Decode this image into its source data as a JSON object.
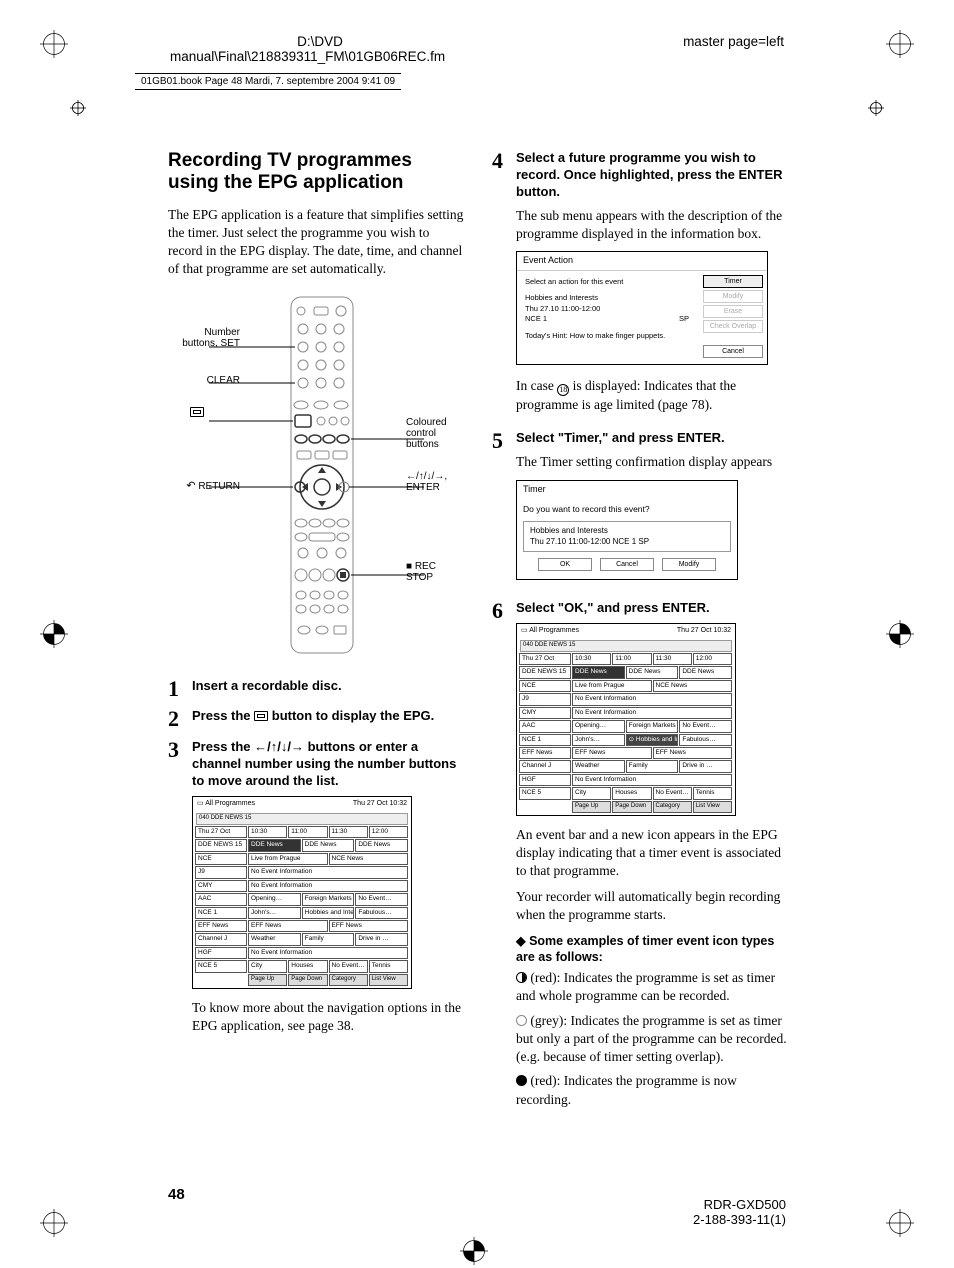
{
  "header": {
    "path_top": "D:\\DVD",
    "path_mid": "manual\\Final\\218839311_FM\\01GB06REC.fm",
    "master": "master page=left",
    "book_info": "01GB01.book  Page 48  Mardi, 7. septembre 2004  9:41 09"
  },
  "page_number": "48",
  "model": {
    "name": "RDR-GXD500",
    "code": "2-188-393-11(1)"
  },
  "section": {
    "title": "Recording TV programmes using the EPG application",
    "intro": "The EPG application is a feature that simplifies setting the timer. Just select the programme you wish to record in the EPG display. The date, time, and channel of that programme are set automatically."
  },
  "remote_labels": {
    "number_set": "Number buttons, SET",
    "clear": "CLEAR",
    "coloured": "Coloured control buttons",
    "return": "RETURN",
    "enter": "←/↑/↓/→, ENTER",
    "rec_stop": "■ REC STOP"
  },
  "steps": {
    "s1": {
      "num": "1",
      "heading": "Insert a recordable disc."
    },
    "s2": {
      "num": "2",
      "heading_a": "Press the ",
      "heading_b": " button to display the EPG."
    },
    "s3": {
      "num": "3",
      "heading": "Press the ←/↑/↓/→ buttons or enter a channel number using the number buttons to move around the list.",
      "after": "To know more about the navigation options in the EPG application, see page 38."
    },
    "s4": {
      "num": "4",
      "heading": "Select a future programme you wish to record. Once highlighted, press the ENTER button.",
      "text": "The sub menu appears with the description of the programme displayed in the information box.",
      "after_a": "In case ",
      "after_b": " is displayed: Indicates that the programme is age limited (page 78)."
    },
    "s5": {
      "num": "5",
      "heading": "Select \"Timer,\" and press ENTER.",
      "text": "The Timer setting confirmation display appears"
    },
    "s6": {
      "num": "6",
      "heading": "Select \"OK,\" and press ENTER.",
      "after1": "An event bar and a new icon appears in the EPG display indicating that a timer event is associated to that programme.",
      "after2": "Your recorder will automatically begin recording when the programme starts."
    }
  },
  "epg": {
    "title": "All Programmes",
    "datetime": "Thu 27 Oct  10:32",
    "numrow": "040    DDE NEWS 15",
    "date_cell": "Thu 27 Oct",
    "times": [
      "10:30",
      "11:00",
      "11:30",
      "12:00"
    ],
    "rows": [
      {
        "ch": "DDE NEWS 15",
        "cells": [
          "DDE News",
          "DDE News",
          "DDE News"
        ],
        "sel": 0
      },
      {
        "ch": "NCE",
        "cells": [
          "Live from Prague",
          "NCE News"
        ]
      },
      {
        "ch": "J9",
        "cells": [
          "No Event Information"
        ]
      },
      {
        "ch": "CMY",
        "cells": [
          "No Event Information"
        ]
      },
      {
        "ch": "AAC",
        "cells": [
          "Opening…",
          "Foreign Markets - Mor…",
          "No Event…"
        ]
      },
      {
        "ch": "NCE 1",
        "cells": [
          "John's…",
          "Hobbies and Interests",
          "Fabulous…"
        ]
      },
      {
        "ch": "EFF News",
        "cells": [
          "EFF News",
          "EFF News"
        ]
      },
      {
        "ch": "Channel J",
        "cells": [
          "Weather",
          "Family",
          "Drive in …"
        ]
      },
      {
        "ch": "HGF",
        "cells": [
          "No Event Information"
        ]
      },
      {
        "ch": "NCE 5",
        "cells": [
          "City",
          "Houses",
          "No Event…",
          "Tennis"
        ]
      }
    ],
    "footer": [
      "Page Up",
      "Page Down",
      "Category",
      "List View"
    ]
  },
  "epg2": {
    "rows": [
      {
        "ch": "DDE NEWS 15",
        "cells": [
          "DDE News",
          "DDE News",
          "DDE News"
        ],
        "sel": 0
      },
      {
        "ch": "NCE",
        "cells": [
          "Live from Prague",
          "NCE News"
        ]
      },
      {
        "ch": "J9",
        "cells": [
          "No Event Information"
        ]
      },
      {
        "ch": "CMY",
        "cells": [
          "No Event Information"
        ]
      },
      {
        "ch": "AAC",
        "cells": [
          "Opening…",
          "Foreign Markets - Mor…",
          "No Event…"
        ]
      },
      {
        "ch": "NCE 1",
        "cells": [
          "John's…",
          "⊙ Hobbies and Interests",
          "Fabulous…"
        ],
        "hl": 1
      },
      {
        "ch": "EFF News",
        "cells": [
          "EFF News",
          "EFF News"
        ]
      },
      {
        "ch": "Channel J",
        "cells": [
          "Weather",
          "Family",
          "Drive in …"
        ]
      },
      {
        "ch": "HGF",
        "cells": [
          "No Event Information"
        ]
      },
      {
        "ch": "NCE 5",
        "cells": [
          "City",
          "Houses",
          "No Event…",
          "Tennis"
        ]
      }
    ]
  },
  "event_dialog": {
    "title": "Event Action",
    "subtitle": "Select an action for this event",
    "prog_name": "Hobbies and Interests",
    "prog_time": "Thu 27.10   11:00-12:00",
    "prog_ch": "NCE 1",
    "prog_quality": "SP",
    "hint": "Today's Hint: How to make finger puppets.",
    "buttons": {
      "timer": "Timer",
      "modify": "Modify",
      "erase": "Erase",
      "check": "Check Overlap",
      "cancel": "Cancel"
    }
  },
  "timer_dialog": {
    "title": "Timer",
    "question": "Do you want to record this event?",
    "prog_name": "Hobbies and Interests",
    "prog_line": "Thu 27.10  11:00-12:00  NCE 1   SP",
    "ok": "OK",
    "cancel": "Cancel",
    "modify": "Modify"
  },
  "icon_examples": {
    "heading": "◆ Some examples of timer event icon types are as follows:",
    "red": " (red): Indicates the programme is set as timer and whole programme can be recorded.",
    "grey": " (grey): Indicates the programme is set as timer but only a part of the programme can be recorded. (e.g. because of timer setting overlap).",
    "rec": " (red): Indicates the programme is now recording."
  }
}
